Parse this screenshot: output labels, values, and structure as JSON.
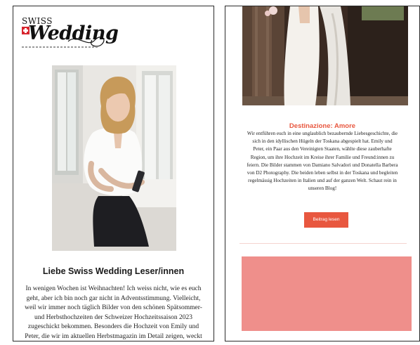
{
  "newsletter": {
    "logo": {
      "top_text": "SWISS",
      "main_text": "Wedding",
      "icon": "swiss-cross-icon"
    },
    "greeting": "Liebe Swiss Wedding Leser/innen",
    "intro": "In wenigen Wochen ist Weihnachten! Ich weiss nicht, wie es euch geht, aber ich bin noch gar nicht in Adventsstimmung. Vielleicht, weil wir immer noch täglich Bilder von den schönen Spätsommer- und Herbsthochzeiten der Schweizer Hochzeitssaison 2023 zugeschickt bekommen. Besonders die Hochzeit von Emily und Peter, die wir im aktuellen Herbstmagazin im Detail zeigen, weckt Sehnsucht nach lauen Sommernächten im Süden – die beiden sind nämlich für ihre"
  },
  "article": {
    "title": "Destinazione: Amore",
    "body": "Wir entführen euch in eine unglaublich bezaubernde Liebesgeschichte, die sich in den idyllischen Hügeln der Toskana abgespielt hat. Emily und Peter, ein Paar aus den Vereinigten Staaten, wählte diese zauberhafte Region, um ihre Hochzeit im Kreise ihrer Familie und Freund:innen zu feiern. Die Bilder stammen von Damiano Salvadori und Donatella Barbera von D2 Photography. Die beiden leben selbst in der Toskana und begleiten regelmässig Hochzeiten in Italien und auf der ganzen Welt. Schaut rein in unseren Blog!",
    "button_label": "Beitrag lesen"
  },
  "colors": {
    "accent": "#e8573f",
    "promo": "#ef8f8b",
    "divider": "#f5d4d0",
    "flag": "#d7262e"
  }
}
